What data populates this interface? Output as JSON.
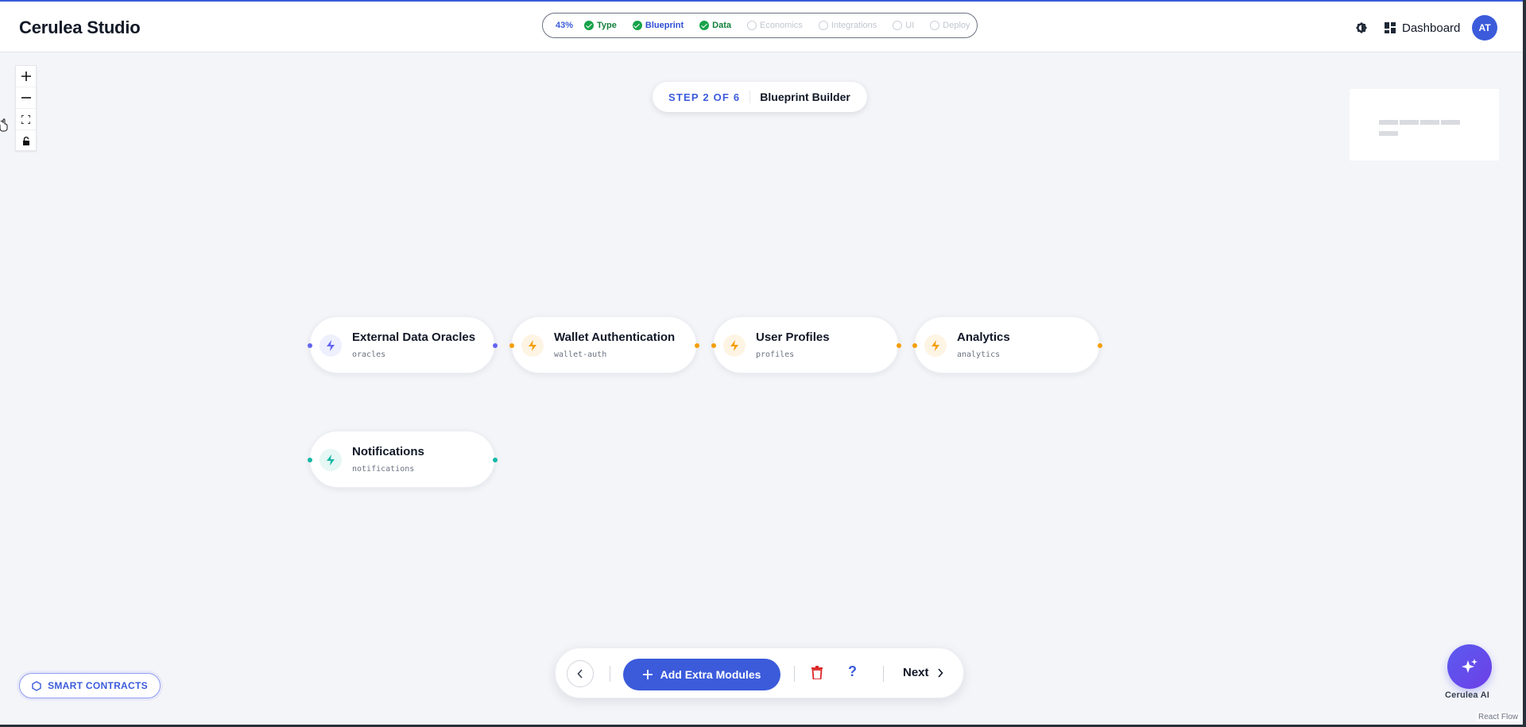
{
  "header": {
    "brand": "Cerulea Studio",
    "progress_percent": "43%",
    "steps": [
      {
        "label": "Type",
        "state": "done"
      },
      {
        "label": "Blueprint",
        "state": "active"
      },
      {
        "label": "Data",
        "state": "done"
      },
      {
        "label": "Economics",
        "state": "todo"
      },
      {
        "label": "Integrations",
        "state": "todo"
      },
      {
        "label": "UI",
        "state": "todo"
      },
      {
        "label": "Deploy",
        "state": "todo"
      }
    ],
    "dashboard_label": "Dashboard",
    "avatar_initials": "AT"
  },
  "canvas": {
    "step_indicator": "STEP 2 OF 6",
    "step_title": "Blueprint Builder",
    "nodes": [
      {
        "title": "External Data Oracles",
        "slug": "oracles",
        "color": "#6366f1"
      },
      {
        "title": "Wallet Authentication",
        "slug": "wallet-auth",
        "color": "#f59e0b"
      },
      {
        "title": "User Profiles",
        "slug": "profiles",
        "color": "#f59e0b"
      },
      {
        "title": "Analytics",
        "slug": "analytics",
        "color": "#f59e0b"
      },
      {
        "title": "Notifications",
        "slug": "notifications",
        "color": "#14b8a6"
      }
    ]
  },
  "toolbar": {
    "add_label": "Add Extra Modules",
    "help_label": "?",
    "next_label": "Next"
  },
  "smart_contracts_label": "SMART CONTRACTS",
  "ai_label": "Cerulea AI",
  "attribution": "React Flow",
  "colors": {
    "accent": "#3b5bdb",
    "done": "#16a34a",
    "danger": "#dc2626"
  }
}
